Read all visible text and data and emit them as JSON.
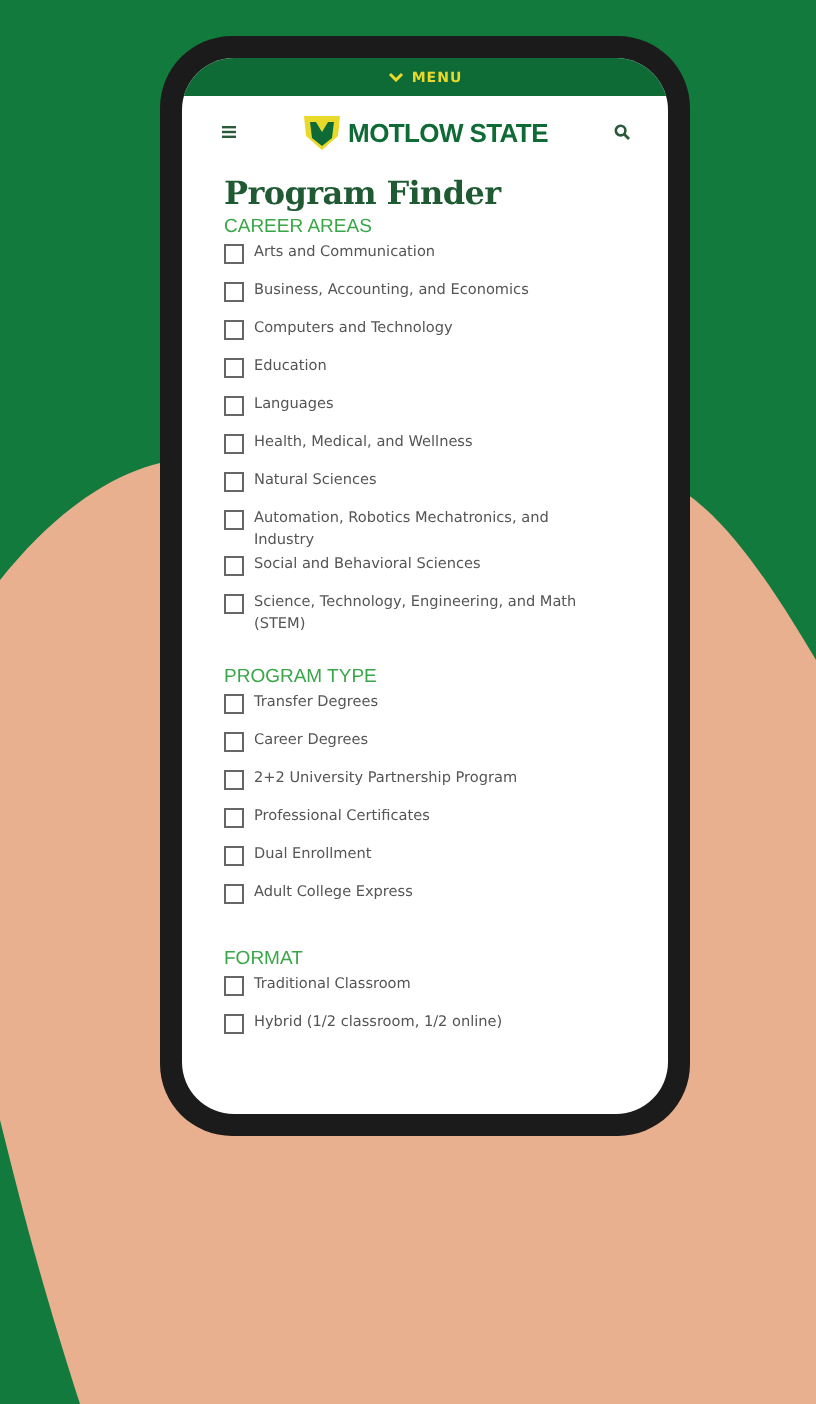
{
  "top_bar": {
    "label": "MENU"
  },
  "header": {
    "logo_text": "MOTLOW STATE"
  },
  "title": "Program Finder",
  "sections": [
    {
      "heading": "CAREER AREAS",
      "options": [
        {
          "label": "Arts and Communication",
          "checked": false
        },
        {
          "label": "Business, Accounting, and Economics",
          "checked": false
        },
        {
          "label": "Computers and Technology",
          "checked": false
        },
        {
          "label": "Education",
          "checked": false
        },
        {
          "label": "Languages",
          "checked": false
        },
        {
          "label": "Health, Medical, and Wellness",
          "checked": false
        },
        {
          "label": "Natural Sciences",
          "checked": false
        },
        {
          "label": "Automation, Robotics Mechatronics, and Industry",
          "checked": false
        },
        {
          "label": "Social and Behavioral Sciences",
          "checked": false
        },
        {
          "label": "Science, Technology, Engineering, and Math (STEM)",
          "checked": false
        }
      ]
    },
    {
      "heading": "PROGRAM TYPE",
      "options": [
        {
          "label": "Transfer Degrees",
          "checked": false
        },
        {
          "label": "Career Degrees",
          "checked": false
        },
        {
          "label": "2+2 University Partnership Program",
          "checked": false
        },
        {
          "label": "Professional Certificates",
          "checked": false
        },
        {
          "label": "Dual Enrollment",
          "checked": false
        },
        {
          "label": "Adult College Express",
          "checked": false
        }
      ]
    },
    {
      "heading": "FORMAT",
      "options": [
        {
          "label": "Traditional Classroom",
          "checked": false
        },
        {
          "label": "Hybrid (1/2 classroom, 1/2 online)",
          "checked": false
        }
      ]
    }
  ]
}
